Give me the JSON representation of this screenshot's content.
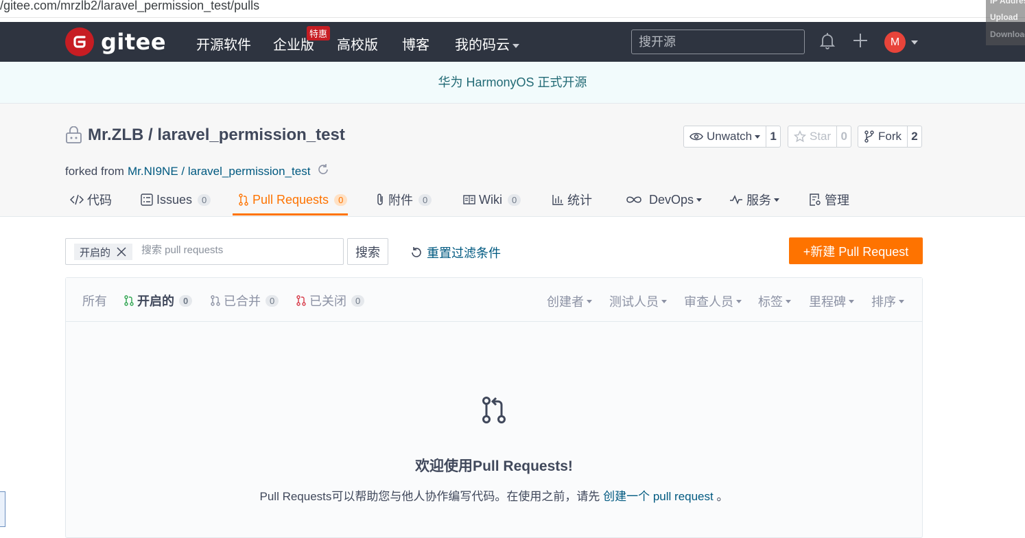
{
  "browser": {
    "url": "/gitee.com/mrzlb2/laravel_permission_test/pulls",
    "ext_lines": [
      "IP Address",
      "Upload",
      "Download"
    ]
  },
  "nav": {
    "logo_text": "gitee",
    "items": [
      "开源软件",
      "企业版",
      "高校版",
      "博客",
      "我的码云"
    ],
    "badge": "特惠",
    "search_placeholder": "搜开源",
    "avatar_letter": "M"
  },
  "banner": {
    "text": "华为 HarmonyOS 正式开源"
  },
  "repo": {
    "title": "Mr.ZLB / laravel_permission_test",
    "forked_prefix": "forked from",
    "forked_link": "Mr.NI9NE / laravel_permission_test",
    "watch": {
      "label": "Unwatch",
      "count": "1"
    },
    "star": {
      "label": "Star",
      "count": "0"
    },
    "fork": {
      "label": "Fork",
      "count": "2"
    }
  },
  "tabs": [
    {
      "label": "代码"
    },
    {
      "label": "Issues",
      "count": "0"
    },
    {
      "label": "Pull Requests",
      "count": "0"
    },
    {
      "label": "附件",
      "count": "0"
    },
    {
      "label": "Wiki",
      "count": "0"
    },
    {
      "label": "统计"
    },
    {
      "label": "DevOps"
    },
    {
      "label": "服务"
    },
    {
      "label": "管理"
    }
  ],
  "filter": {
    "chip": "开启的",
    "placeholder": "搜索 pull requests",
    "search_btn": "搜索",
    "reset": "重置过滤条件",
    "new_pr": "+新建 Pull Request"
  },
  "states": [
    {
      "label": "所有"
    },
    {
      "label": "开启的",
      "count": "0"
    },
    {
      "label": "已合并",
      "count": "0"
    },
    {
      "label": "已关闭",
      "count": "0"
    }
  ],
  "dropdowns": [
    "创建者",
    "测试人员",
    "审查人员",
    "标签",
    "里程碑",
    "排序"
  ],
  "empty": {
    "title": "欢迎使用Pull Requests!",
    "desc_prefix": "Pull Requests可以帮助您与他人协作编写代码。在使用之前，请先 ",
    "desc_link": "创建一个 pull request",
    "desc_suffix": " 。"
  },
  "colors": {
    "accent": "#fe7300",
    "navbar": "#2e3440",
    "link": "#005980",
    "brand": "#c71d23"
  }
}
